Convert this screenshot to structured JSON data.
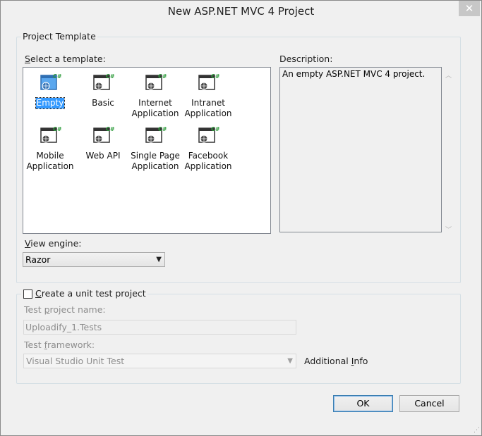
{
  "window": {
    "title": "New ASP.NET MVC 4 Project",
    "close_glyph": "✕"
  },
  "project_template": {
    "group_label": "Project Template",
    "select_label_prefix": "S",
    "select_label_rest": "elect a template:",
    "templates": [
      {
        "label_line1": "Empty",
        "label_line2": "",
        "selected": true,
        "icon": "mvc-project-icon"
      },
      {
        "label_line1": "Basic",
        "label_line2": "",
        "selected": false,
        "icon": "mvc-project-icon"
      },
      {
        "label_line1": "Internet",
        "label_line2": "Application",
        "selected": false,
        "icon": "mvc-project-icon"
      },
      {
        "label_line1": "Intranet",
        "label_line2": "Application",
        "selected": false,
        "icon": "mvc-project-icon"
      },
      {
        "label_line1": "Mobile",
        "label_line2": "Application",
        "selected": false,
        "icon": "mvc-project-icon"
      },
      {
        "label_line1": "Web API",
        "label_line2": "",
        "selected": false,
        "icon": "mvc-project-icon"
      },
      {
        "label_line1": "Single Page",
        "label_line2": "Application",
        "selected": false,
        "icon": "mvc-project-icon"
      },
      {
        "label_line1": "Facebook",
        "label_line2": "Application",
        "selected": false,
        "icon": "mvc-project-icon"
      }
    ],
    "icon_badge": "C#",
    "description_label": "Description:",
    "description_text": "An empty ASP.NET MVC 4 project.",
    "view_engine_prefix": "V",
    "view_engine_rest": "iew engine:",
    "view_engine_value": "Razor"
  },
  "unit_test": {
    "checkbox_prefix": "C",
    "checkbox_rest": "reate a unit test project",
    "checked": false,
    "project_name_a": "Test ",
    "project_name_u": "p",
    "project_name_b": "roject name:",
    "project_name_value": "Uploadify_1.Tests",
    "framework_a": "Test ",
    "framework_u": "f",
    "framework_b": "ramework:",
    "framework_value": "Visual Studio Unit Test",
    "additional_info_a": "Additional ",
    "additional_info_u": "I",
    "additional_info_b": "nfo"
  },
  "buttons": {
    "ok": "OK",
    "cancel": "Cancel"
  },
  "colors": {
    "selection": "#3399ff",
    "icon_badge_green": "#2e9c3c",
    "icon_blue": "#3b8fd6"
  }
}
